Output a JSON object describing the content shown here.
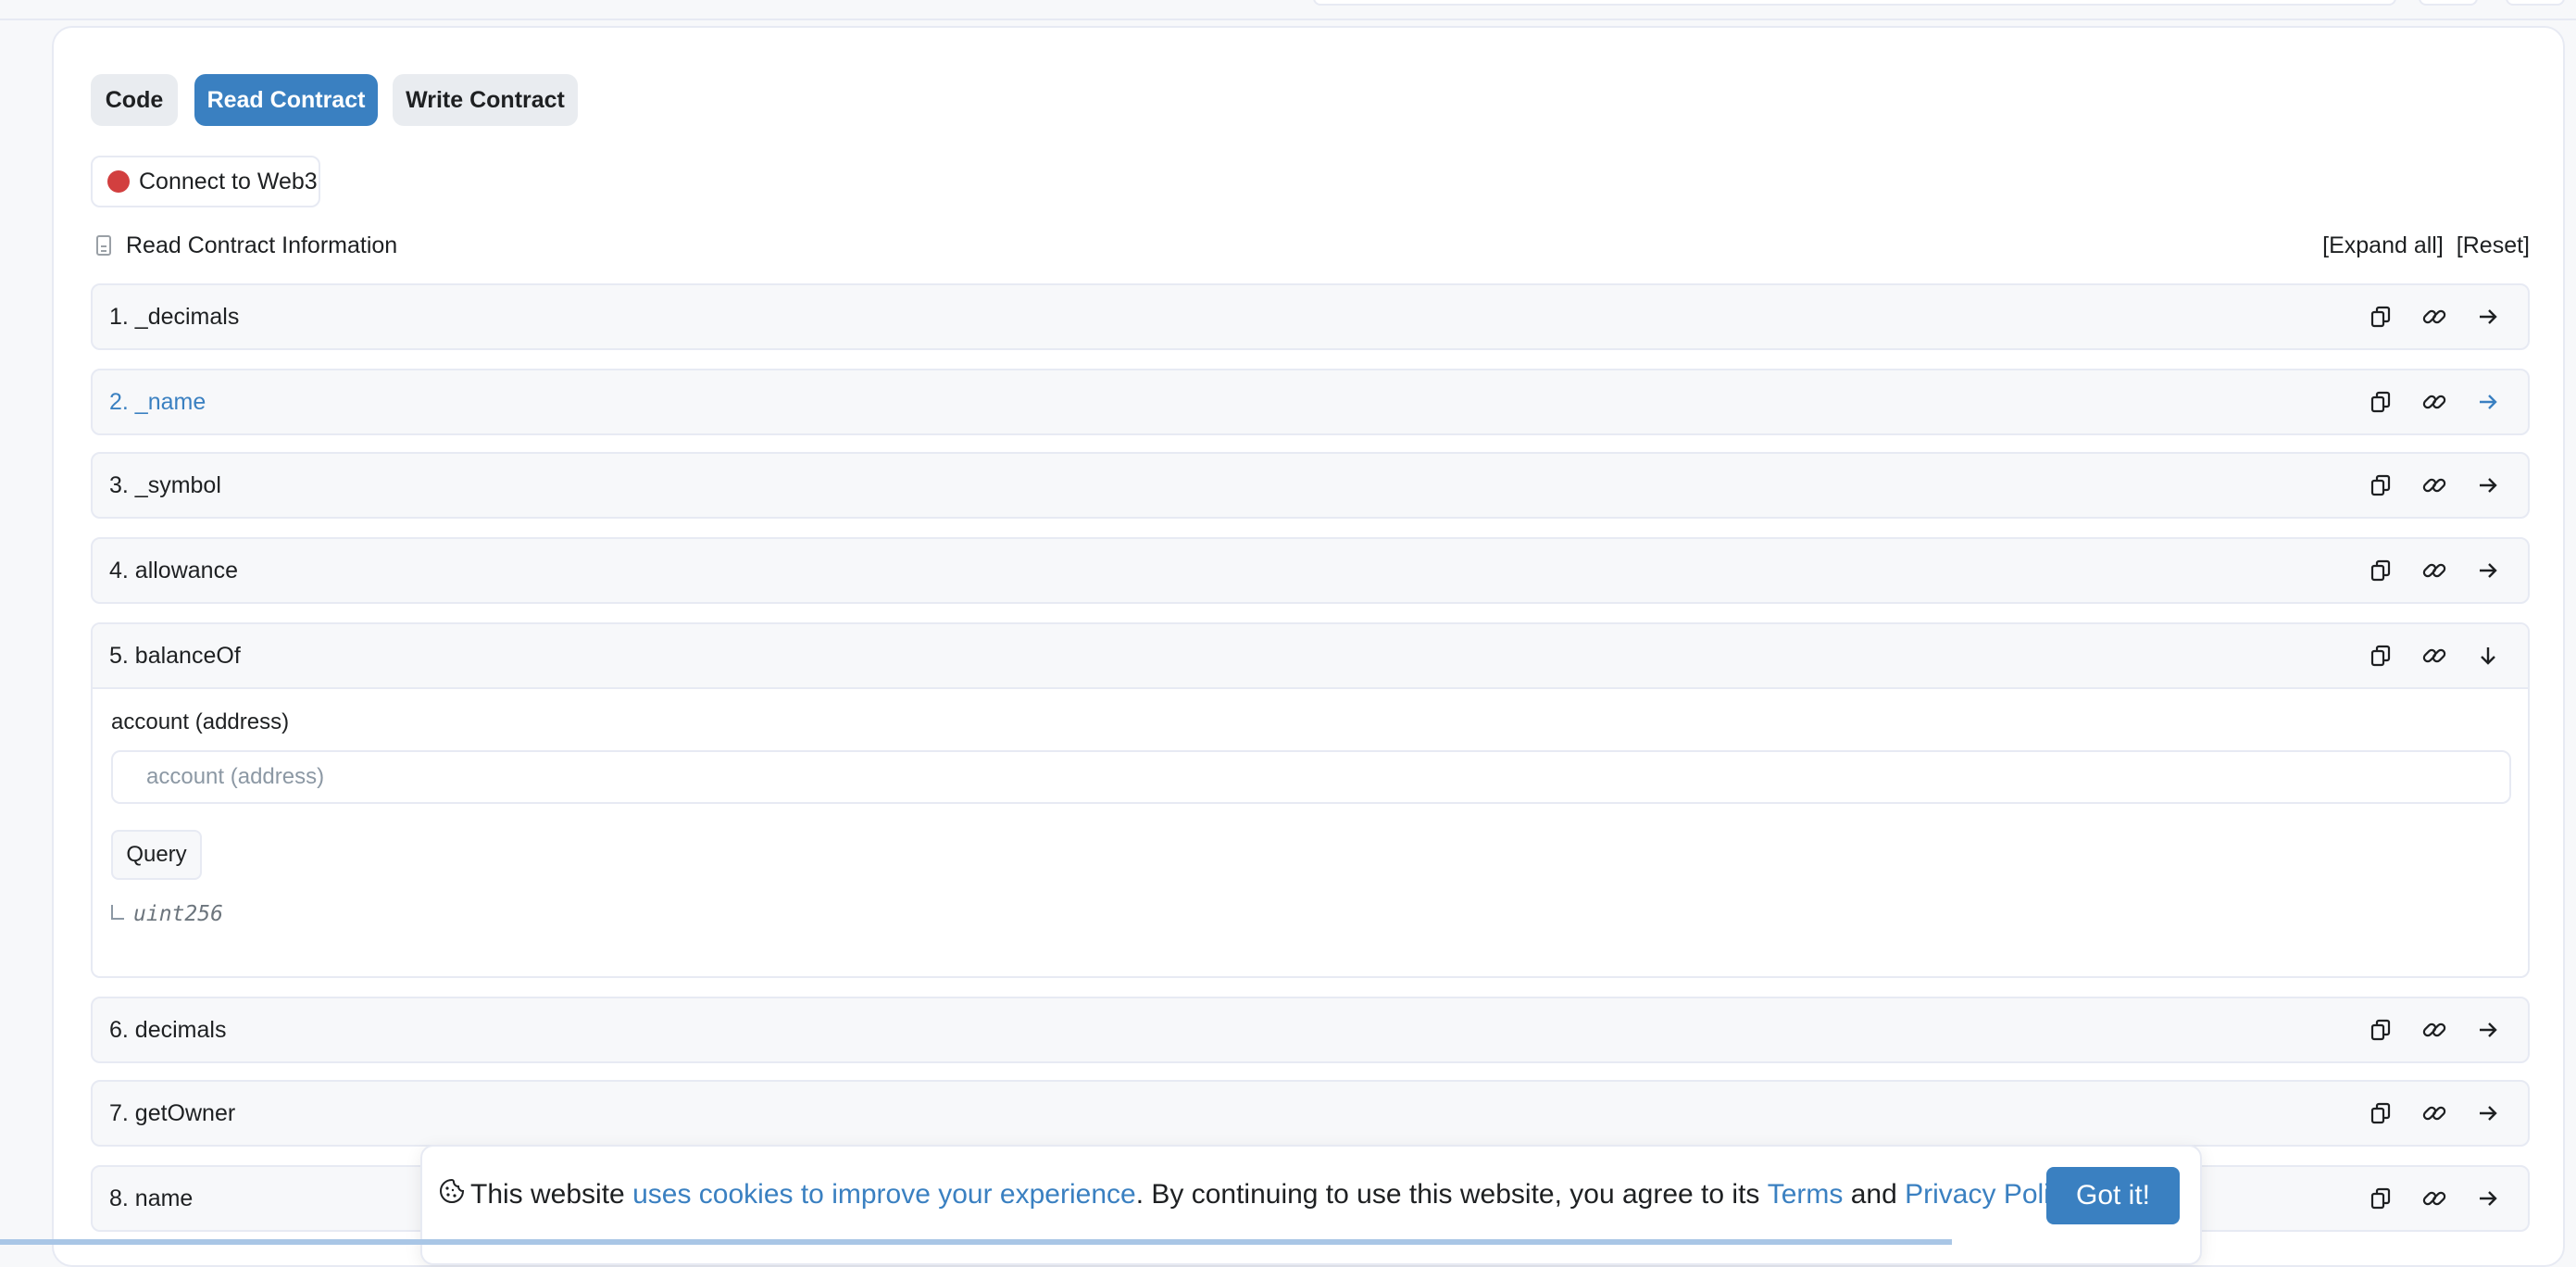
{
  "tabs": [
    {
      "label": "Code",
      "active": false
    },
    {
      "label": "Read Contract",
      "active": true
    },
    {
      "label": "Write Contract",
      "active": false
    }
  ],
  "connect": {
    "label": "Connect to Web3",
    "status_color": "#d23f3f"
  },
  "section": {
    "title": "Read Contract Information",
    "expand_all": "[Expand all]",
    "reset": "[Reset]"
  },
  "functions": [
    {
      "label": "1. _decimals"
    },
    {
      "label": "2. _name",
      "highlighted": true
    },
    {
      "label": "3. _symbol"
    },
    {
      "label": "4. allowance"
    },
    {
      "label": "5. balanceOf",
      "expanded": true
    },
    {
      "label": "6. decimals"
    },
    {
      "label": "7. getOwner"
    },
    {
      "label": "8. name"
    }
  ],
  "balanceOf": {
    "input_label": "account (address)",
    "input_placeholder": "account (address)",
    "input_value": "",
    "query_label": "Query",
    "return_type": "uint256"
  },
  "cookie": {
    "text_1": "This website ",
    "link_1": "uses cookies to improve your experience",
    "text_2": ". By continuing to use this website, you agree to its ",
    "terms": "Terms",
    "text_3": " and ",
    "privacy": "Privacy Policy",
    "text_4": ".",
    "button": "Got it!"
  },
  "colors": {
    "accent": "#3a80c1",
    "row_bg": "#f7f8fa",
    "border": "#e7eaf3"
  },
  "icons": [
    "copy-icon",
    "link-icon",
    "arrow-right-icon",
    "arrow-down-icon",
    "document-icon",
    "cookie-icon"
  ]
}
